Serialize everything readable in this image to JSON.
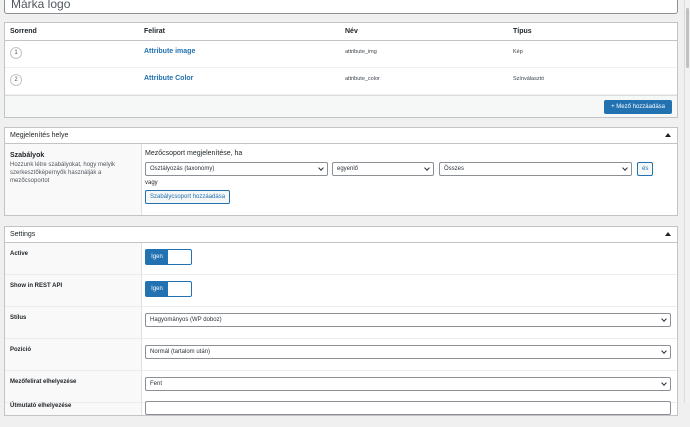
{
  "title_value": "Márka logo",
  "fields_table": {
    "headers": {
      "order": "Sorrend",
      "label": "Felirat",
      "name": "Név",
      "type": "Típus"
    },
    "rows": [
      {
        "order": "1",
        "label": "Attribute image",
        "name": "attribute_img",
        "type": "Kép"
      },
      {
        "order": "2",
        "label": "Attribute Color",
        "name": "attribute_color",
        "type": "Színválasztó"
      }
    ],
    "add_button": "+ Mező hozzáadása"
  },
  "location": {
    "title": "Megjelenítés helye",
    "rules_title": "Szabályok",
    "rules_desc": "Hozzunk létre szabályokat, hogy melyik szerkesztőképernyők használják a mezőcsoportot",
    "rule_label": "Mezőcsoport megjelenítése, ha",
    "param": "Osztályozás (taxonomy)",
    "operator": "egyenlő",
    "value": "Összes",
    "and_button": "és",
    "or_label": "vagy",
    "add_group_button": "Szabálycsoport hozzáadása"
  },
  "settings": {
    "title": "Settings",
    "active_label": "Active",
    "active_value": "Igen",
    "rest_label": "Show in REST API",
    "rest_value": "Igen",
    "style_label": "Stílus",
    "style_value": "Hagyományos (WP doboz)",
    "position_label": "Pozíció",
    "position_value": "Normál (tartalom után)",
    "label_place_label": "Mezőfelirat elhelyezése",
    "label_place_value": "Fent",
    "instr_label": "Útmutató elhelyezése"
  },
  "colors": {
    "primary": "#2271b1",
    "border": "#c3c4c7",
    "background": "#f0f0f1"
  }
}
